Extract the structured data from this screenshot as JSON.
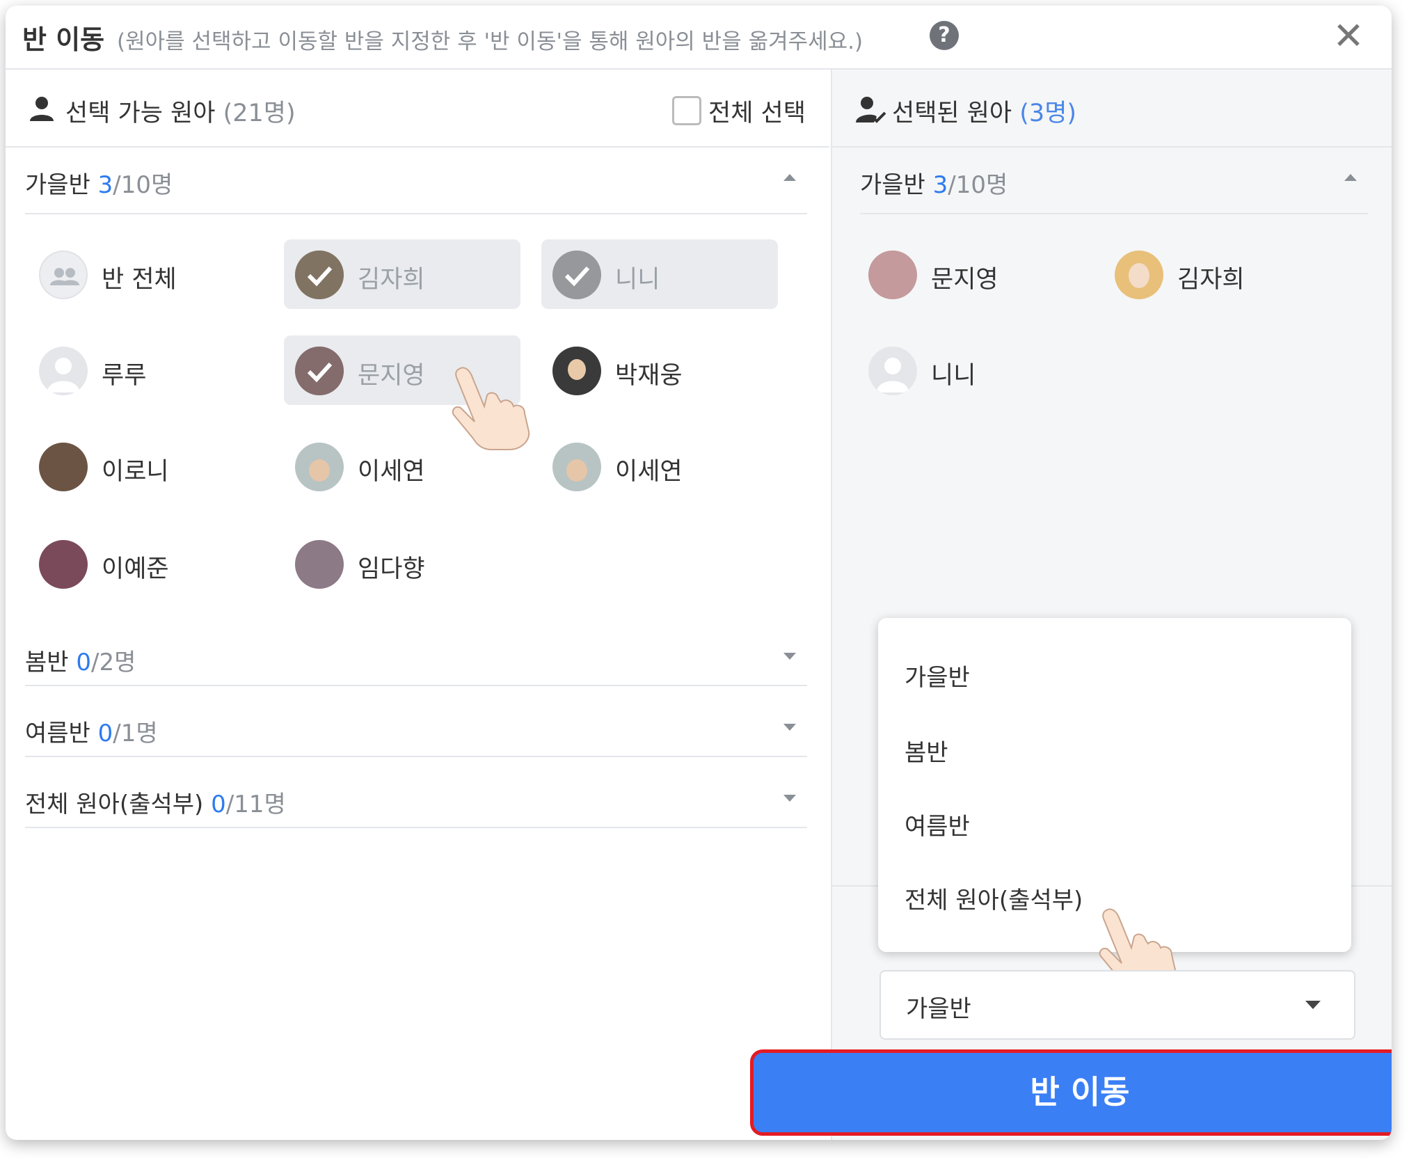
{
  "header": {
    "title": "반 이동",
    "description": "(원아를 선택하고 이동할 반을 지정한 후 '반 이동'을 통해 원아의 반을 옮겨주세요.)",
    "help": "?",
    "close": "✕"
  },
  "left": {
    "title": "선택 가능 원아",
    "count": "(21명)",
    "select_all": "전체 선택",
    "groups": [
      {
        "name": "가을반",
        "sel": "3",
        "total": "/10명"
      },
      {
        "name": "봄반",
        "sel": "0",
        "total": "/2명"
      },
      {
        "name": "여름반",
        "sel": "0",
        "total": "/1명"
      },
      {
        "name": "전체 원아(출석부)",
        "sel": "0",
        "total": "/11명"
      }
    ],
    "children": [
      "반 전체",
      "김자희",
      "니니",
      "루루",
      "문지영",
      "박재웅",
      "이로니",
      "이세연",
      "이세연",
      "이예준",
      "임다향"
    ]
  },
  "right": {
    "title": "선택된 원아",
    "count": "(3명)",
    "group": {
      "name": "가을반",
      "sel": "3",
      "total": "/10명"
    },
    "children": [
      "문지영",
      "김자희",
      "니니"
    ]
  },
  "dropdown": {
    "options": [
      "가을반",
      "봄반",
      "여름반",
      "전체 원아(출석부)"
    ],
    "selected": "가을반"
  },
  "move_button": "반 이동",
  "colors": {
    "accent": "#3b7ff5",
    "highlight_border": "#e41b23",
    "count_blue": "#2d7bf0"
  }
}
